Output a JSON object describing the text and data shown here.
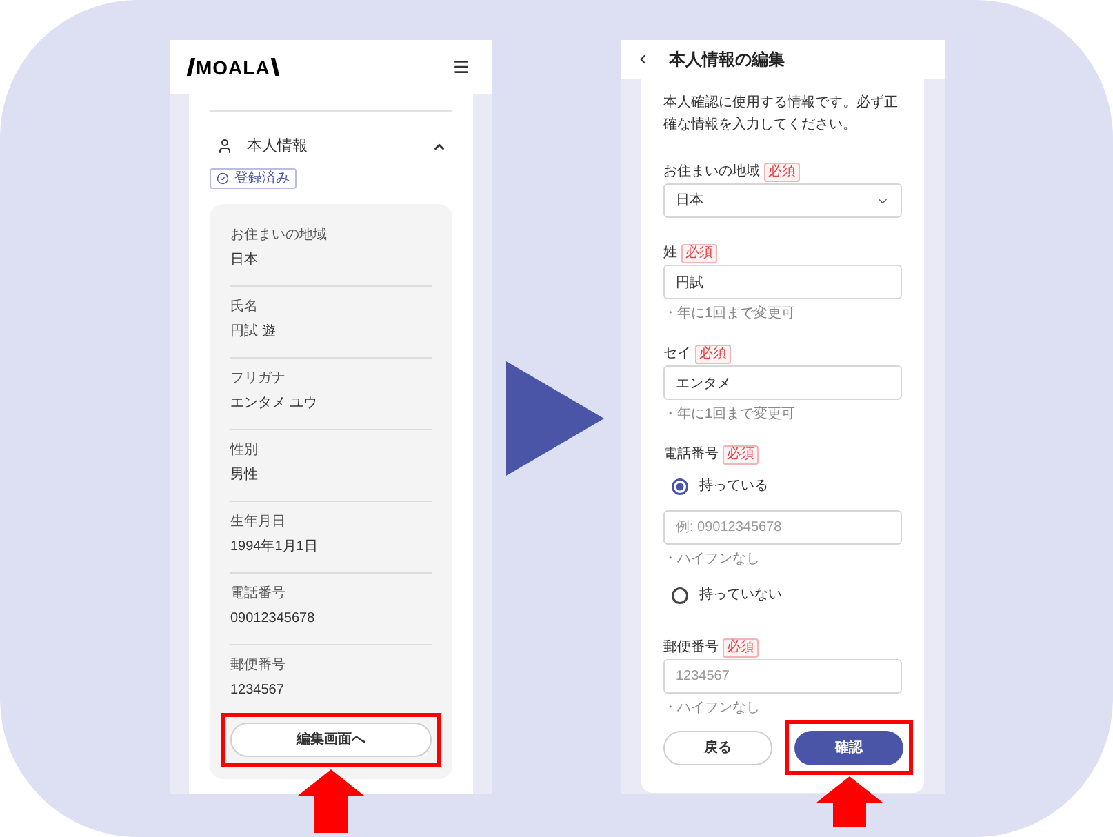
{
  "left_screen": {
    "logo": "MOALA",
    "section": {
      "title": "本人情報",
      "expanded": true,
      "badge": "登録済み",
      "fields": [
        {
          "label": "お住まいの地域",
          "value": "日本"
        },
        {
          "label": "氏名",
          "value": "円試 遊"
        },
        {
          "label": "フリガナ",
          "value": "エンタメ ユウ"
        },
        {
          "label": "性別",
          "value": "男性"
        },
        {
          "label": "生年月日",
          "value": "1994年1月1日"
        },
        {
          "label": "電話番号",
          "value": "09012345678"
        },
        {
          "label": "郵便番号",
          "value": "1234567"
        }
      ],
      "edit_button": {
        "label": "編集画面へ",
        "highlighted": true
      }
    }
  },
  "right_screen": {
    "title": "本人情報の編集",
    "intro": "本人確認に使用する情報です。必ず正確な情報を入力してください。",
    "fields": [
      {
        "kind": "select",
        "label": "お住まいの地域",
        "badge": "必須",
        "value": "日本"
      },
      {
        "kind": "text",
        "label": "姓",
        "badge": "必須",
        "value": "円試",
        "hint": "・年に1回まで変更可"
      },
      {
        "kind": "text",
        "label": "セイ",
        "badge": "必須",
        "value": "エンタメ",
        "hint": "・年に1回まで変更可"
      },
      {
        "kind": "radio",
        "label": "電話番号",
        "badge": "必須",
        "options": [
          {
            "label": "持っている",
            "selected": true,
            "input": {
              "placeholder": "例: 09012345678",
              "hint": "・ハイフンなし"
            }
          },
          {
            "label": "持っていない",
            "selected": false
          }
        ]
      },
      {
        "kind": "text",
        "label": "郵便番号",
        "badge": "必須",
        "placeholder": "1234567",
        "hint": "・ハイフンなし"
      }
    ],
    "buttons": [
      {
        "label": "戻る",
        "kind": "secondary",
        "highlighted": false
      },
      {
        "label": "確認",
        "kind": "primary",
        "highlighted": true
      }
    ]
  }
}
